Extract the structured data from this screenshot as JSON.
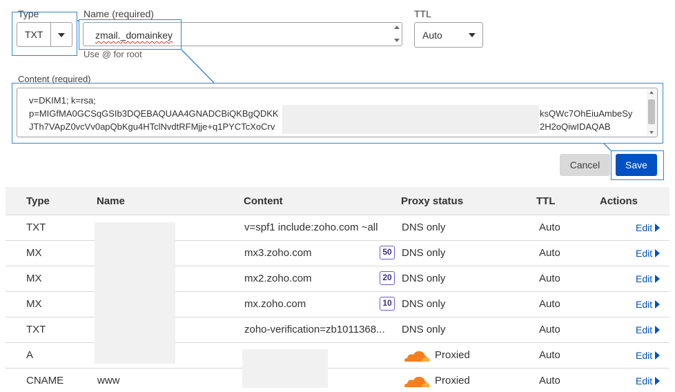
{
  "form": {
    "type_label": "Type",
    "type_value": "TXT",
    "name_label": "Name (required)",
    "name_value": "zmail._domainkey",
    "name_hint": "Use @ for root",
    "ttl_label": "TTL",
    "ttl_value": "Auto",
    "content_label": "Content (required)",
    "content_lines": [
      "v=DKIM1; k=rsa;",
      "p=MIGfMA0GCSqGSIb3DQEBAQUAA4GNADCBiQKBgQDKK",
      "JTh7VApZ0vcVv0apQbKgu4HTclNvdtRFMjje+q1PYCTcXoCrv"
    ],
    "content_tail_lines": [
      "ksQWc7OhEiuAmbeSy",
      "2H2oQiwIDAQAB"
    ],
    "cancel_label": "Cancel",
    "save_label": "Save"
  },
  "table": {
    "headers": {
      "type": "Type",
      "name": "Name",
      "content": "Content",
      "proxy": "Proxy status",
      "ttl": "TTL",
      "actions": "Actions"
    },
    "rows": [
      {
        "type": "TXT",
        "name": "",
        "content": "v=spf1 include:zoho.com ~all",
        "priority": "",
        "proxy": "DNS only",
        "ttl": "Auto",
        "action": "Edit"
      },
      {
        "type": "MX",
        "name": "",
        "content": "mx3.zoho.com",
        "priority": "50",
        "proxy": "DNS only",
        "ttl": "Auto",
        "action": "Edit"
      },
      {
        "type": "MX",
        "name": "",
        "content": "mx2.zoho.com",
        "priority": "20",
        "proxy": "DNS only",
        "ttl": "Auto",
        "action": "Edit"
      },
      {
        "type": "MX",
        "name": "",
        "content": "mx.zoho.com",
        "priority": "10",
        "proxy": "DNS only",
        "ttl": "Auto",
        "action": "Edit"
      },
      {
        "type": "TXT",
        "name": "",
        "content": "zoho-verification=zb1011368...",
        "priority": "",
        "proxy": "DNS only",
        "ttl": "Auto",
        "action": "Edit"
      },
      {
        "type": "A",
        "name": "",
        "content": "",
        "priority": "",
        "proxy": "Proxied",
        "ttl": "Auto",
        "action": "Edit"
      },
      {
        "type": "CNAME",
        "name": "www",
        "content": "",
        "priority": "",
        "proxy": "Proxied",
        "ttl": "Auto",
        "action": "Edit"
      }
    ]
  },
  "colors": {
    "accent_blue": "#0051c3",
    "annotation_blue": "#2f83d6",
    "cloud_orange": "#f38020",
    "priority_purple": "#6f56d9"
  },
  "icons": {
    "dropdown": "chevron-down-icon",
    "edit": "caret-right-icon",
    "proxy": "cloud-icon"
  }
}
